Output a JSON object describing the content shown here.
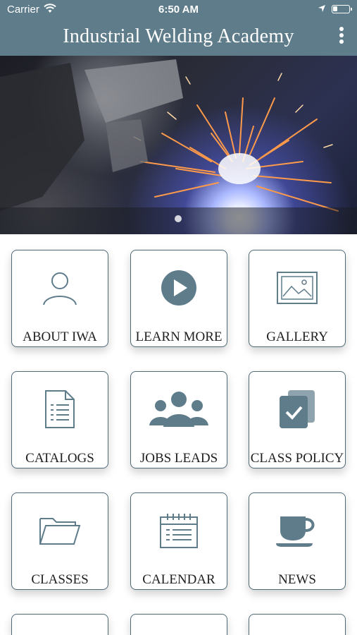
{
  "status_bar": {
    "carrier": "Carrier",
    "time": "6:50 AM"
  },
  "header": {
    "title": "Industrial Welding Academy"
  },
  "colors": {
    "header": "#5f7c8b",
    "icon": "#5f7c8b",
    "tile_border": "#4f6977"
  },
  "tiles": [
    {
      "label": "ABOUT IWA",
      "icon": "person-icon"
    },
    {
      "label": "LEARN MORE",
      "icon": "play-icon"
    },
    {
      "label": "GALLERY",
      "icon": "image-icon"
    },
    {
      "label": "CATALOGS",
      "icon": "document-icon"
    },
    {
      "label": "JOBS LEADS",
      "icon": "group-icon"
    },
    {
      "label": "CLASS POLICY",
      "icon": "checklist-icon"
    },
    {
      "label": "CLASSES",
      "icon": "folder-icon"
    },
    {
      "label": "CALENDAR",
      "icon": "calendar-icon"
    },
    {
      "label": "NEWS",
      "icon": "coffee-cup-icon"
    }
  ]
}
